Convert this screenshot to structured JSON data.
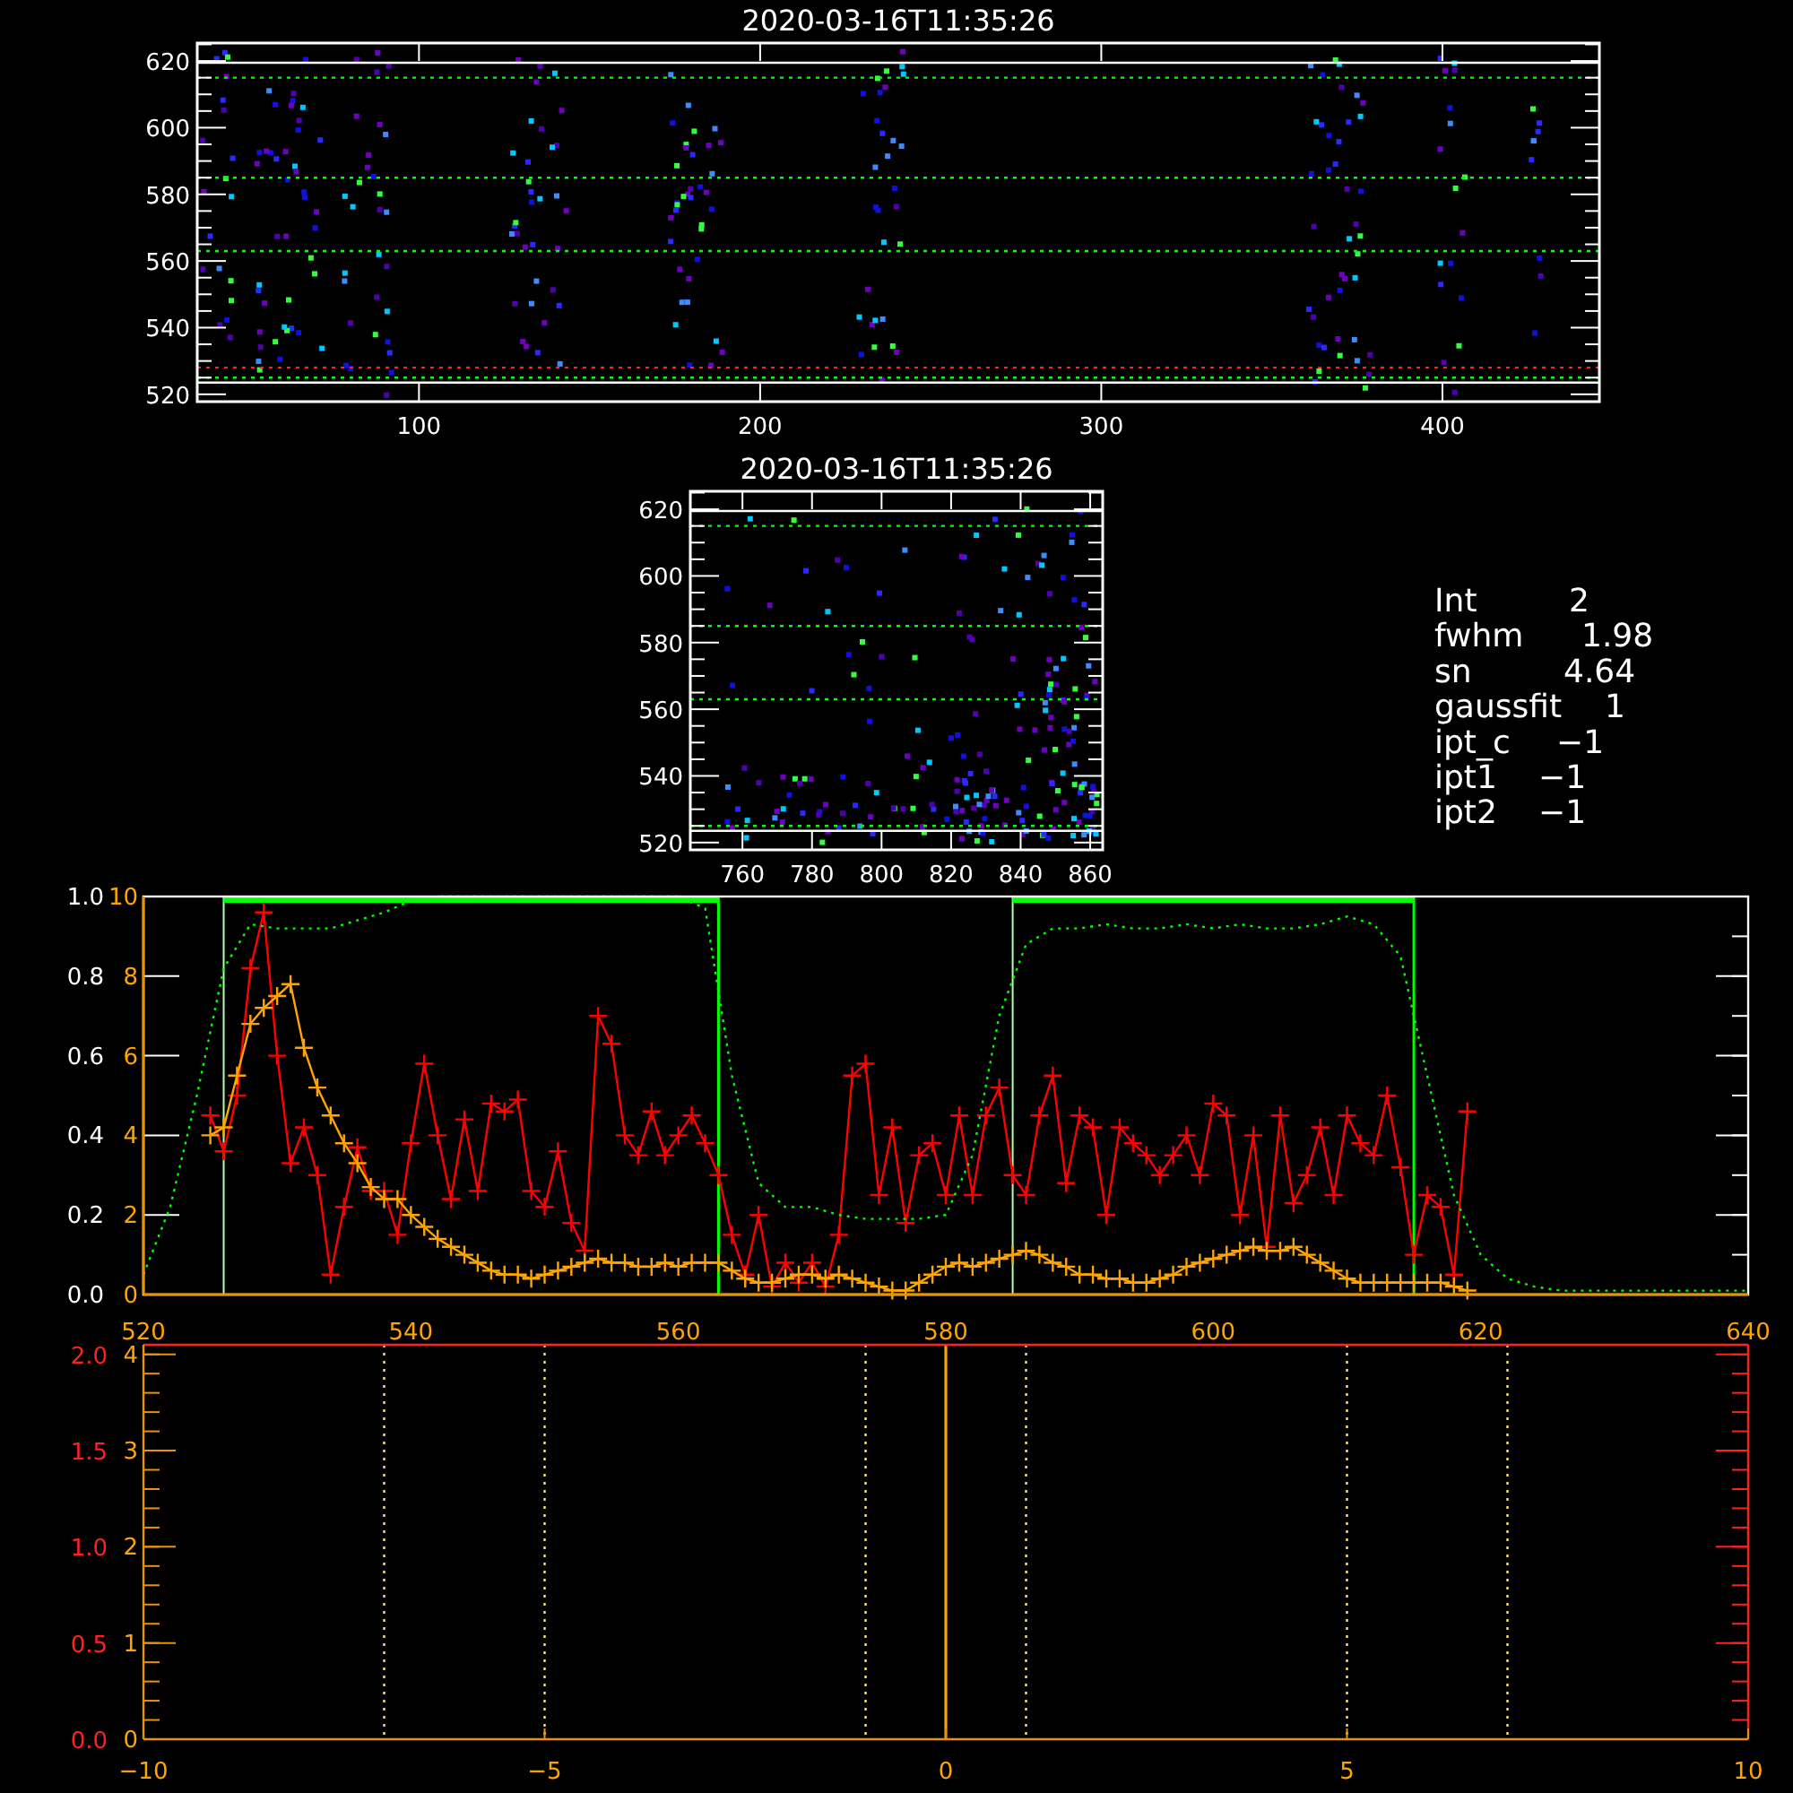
{
  "image_panels": [
    {
      "title": "2020-03-16T11:35:26",
      "xticks": [
        "100",
        "200",
        "300",
        "400"
      ],
      "yticks": [
        "620",
        "600",
        "580",
        "560",
        "540",
        "520"
      ]
    },
    {
      "title": "2020-03-16T11:35:26",
      "xticks": [
        "760",
        "780",
        "800",
        "820",
        "840",
        "860"
      ],
      "yticks": [
        "620",
        "600",
        "580",
        "560",
        "540",
        "520"
      ]
    }
  ],
  "fit_info": [
    {
      "label": "Int",
      "value": "2"
    },
    {
      "label": "fwhm",
      "value": "1.98"
    },
    {
      "label": "sn",
      "value": "4.64"
    },
    {
      "label": "gaussfit",
      "value": "1"
    },
    {
      "label": "ipt_c",
      "value": "−1"
    },
    {
      "label": "ipt1",
      "value": "−1"
    },
    {
      "label": "ipt2",
      "value": "−1"
    }
  ],
  "profile_plot": {
    "overlay_axis_labels": [
      "10",
      "8",
      "6",
      "4",
      "2",
      "0"
    ],
    "chart_data": {
      "type": "line",
      "xlim": [
        520,
        640
      ],
      "ylim": [
        0,
        1
      ],
      "xticks": [
        520,
        540,
        560,
        580,
        600,
        620,
        640
      ],
      "yticks": [
        {
          "value": 0,
          "label": "0.0"
        },
        {
          "value": 0.2,
          "label": "0.2"
        },
        {
          "value": 0.4,
          "label": "0.4"
        },
        {
          "value": 0.6,
          "label": "0.6"
        },
        {
          "value": 0.8,
          "label": "0.8"
        },
        {
          "value": 1,
          "label": "1.0"
        }
      ],
      "series": [
        {
          "color": "#ff0000",
          "line_style": "solid",
          "marker": "+",
          "x": [
            525,
            526,
            527,
            528,
            529,
            530,
            531,
            532,
            533,
            534,
            535,
            536,
            537,
            538,
            539,
            540,
            541,
            542,
            543,
            544,
            545,
            546,
            547,
            548,
            549,
            550,
            551,
            552,
            553,
            554,
            555,
            556,
            557,
            558,
            559,
            560,
            561,
            562,
            563,
            564,
            565,
            566,
            567,
            568,
            569,
            570,
            571,
            572,
            573,
            574,
            575,
            576,
            577,
            578,
            579,
            580,
            581,
            582,
            583,
            584,
            585,
            586,
            587,
            588,
            589,
            590,
            591,
            592,
            593,
            594,
            595,
            596,
            597,
            598,
            599,
            600,
            601,
            602,
            603,
            604,
            605,
            606,
            607,
            608,
            609,
            610,
            611,
            612,
            613,
            614,
            615,
            616,
            617,
            618,
            619
          ],
          "values": [
            0.45,
            0.36,
            0.5,
            0.82,
            0.96,
            0.6,
            0.33,
            0.42,
            0.3,
            0.05,
            0.22,
            0.37,
            0.26,
            0.26,
            0.15,
            0.38,
            0.58,
            0.4,
            0.24,
            0.44,
            0.26,
            0.48,
            0.46,
            0.49,
            0.26,
            0.22,
            0.36,
            0.18,
            0.11,
            0.7,
            0.63,
            0.4,
            0.35,
            0.46,
            0.35,
            0.4,
            0.45,
            0.38,
            0.3,
            0.15,
            0.05,
            0.2,
            0.02,
            0.08,
            0.03,
            0.08,
            0.02,
            0.15,
            0.55,
            0.58,
            0.25,
            0.42,
            0.18,
            0.35,
            0.38,
            0.25,
            0.45,
            0.25,
            0.45,
            0.52,
            0.3,
            0.25,
            0.45,
            0.55,
            0.28,
            0.45,
            0.42,
            0.2,
            0.42,
            0.38,
            0.35,
            0.3,
            0.35,
            0.4,
            0.3,
            0.48,
            0.45,
            0.2,
            0.4,
            0.12,
            0.45,
            0.23,
            0.3,
            0.42,
            0.25,
            0.45,
            0.38,
            0.35,
            0.5,
            0.32,
            0.1,
            0.25,
            0.22,
            0.05,
            0.46
          ]
        },
        {
          "color": "#ffa500",
          "line_style": "solid",
          "marker": "+",
          "x": [
            525,
            526,
            527,
            528,
            529,
            530,
            531,
            532,
            533,
            534,
            535,
            536,
            537,
            538,
            539,
            540,
            541,
            542,
            543,
            544,
            545,
            546,
            547,
            548,
            549,
            550,
            551,
            552,
            553,
            554,
            555,
            556,
            557,
            558,
            559,
            560,
            561,
            562,
            563,
            564,
            565,
            566,
            567,
            568,
            569,
            570,
            571,
            572,
            573,
            574,
            575,
            576,
            577,
            578,
            579,
            580,
            581,
            582,
            583,
            584,
            585,
            586,
            587,
            588,
            589,
            590,
            591,
            592,
            593,
            594,
            595,
            596,
            597,
            598,
            599,
            600,
            601,
            602,
            603,
            604,
            605,
            606,
            607,
            608,
            609,
            610,
            611,
            612,
            613,
            614,
            615,
            616,
            617,
            618,
            619
          ],
          "values": [
            0.4,
            0.42,
            0.55,
            0.68,
            0.72,
            0.75,
            0.78,
            0.62,
            0.52,
            0.45,
            0.38,
            0.33,
            0.27,
            0.24,
            0.24,
            0.2,
            0.17,
            0.14,
            0.12,
            0.1,
            0.08,
            0.06,
            0.05,
            0.05,
            0.04,
            0.05,
            0.06,
            0.07,
            0.08,
            0.09,
            0.08,
            0.08,
            0.07,
            0.07,
            0.08,
            0.07,
            0.08,
            0.08,
            0.08,
            0.06,
            0.04,
            0.03,
            0.03,
            0.04,
            0.05,
            0.05,
            0.04,
            0.05,
            0.04,
            0.03,
            0.02,
            0.01,
            0.01,
            0.03,
            0.05,
            0.07,
            0.08,
            0.07,
            0.08,
            0.09,
            0.1,
            0.11,
            0.1,
            0.08,
            0.07,
            0.05,
            0.05,
            0.04,
            0.04,
            0.03,
            0.03,
            0.04,
            0.05,
            0.07,
            0.08,
            0.09,
            0.1,
            0.11,
            0.12,
            0.11,
            0.11,
            0.12,
            0.1,
            0.08,
            0.06,
            0.04,
            0.03,
            0.03,
            0.03,
            0.03,
            0.03,
            0.03,
            0.03,
            0.02,
            0.01
          ]
        },
        {
          "color": "#00ff00",
          "line_style": "dotted",
          "x": [
            520,
            522,
            524,
            526,
            528,
            530,
            532,
            534,
            536,
            538,
            540,
            542,
            544,
            546,
            548,
            550,
            552,
            554,
            556,
            558,
            560,
            562,
            564,
            566,
            568,
            570,
            572,
            574,
            576,
            578,
            580,
            582,
            584,
            586,
            588,
            590,
            592,
            594,
            596,
            598,
            600,
            602,
            604,
            606,
            608,
            610,
            612,
            614,
            616,
            618,
            620,
            622,
            624,
            626,
            628,
            630,
            632,
            634,
            636,
            638,
            640
          ],
          "values": [
            0.05,
            0.22,
            0.5,
            0.82,
            0.93,
            0.92,
            0.92,
            0.92,
            0.94,
            0.96,
            0.99,
            1,
            1,
            1,
            1,
            1,
            1,
            1,
            1,
            1,
            1,
            0.97,
            0.55,
            0.28,
            0.22,
            0.22,
            0.2,
            0.19,
            0.19,
            0.19,
            0.2,
            0.35,
            0.7,
            0.88,
            0.92,
            0.92,
            0.93,
            0.92,
            0.92,
            0.93,
            0.92,
            0.93,
            0.92,
            0.92,
            0.93,
            0.95,
            0.93,
            0.85,
            0.55,
            0.25,
            0.1,
            0.04,
            0.02,
            0.01,
            0.01,
            0.01,
            0.01,
            0.01,
            0.01,
            0.01,
            0.01
          ]
        }
      ]
    }
  },
  "offset_plot": {
    "overlay_axis_labels": [
      "4",
      "3",
      "2",
      "1",
      "0"
    ],
    "chart_data": {
      "type": "line",
      "xlim": [
        -10,
        10
      ],
      "ylim": [
        0,
        2.05
      ],
      "xticks": [
        {
          "value": -10,
          "label": "−10"
        },
        {
          "value": -5,
          "label": "−5"
        },
        {
          "value": 0,
          "label": "0"
        },
        {
          "value": 5,
          "label": "5"
        },
        {
          "value": 10,
          "label": "10"
        }
      ],
      "yticks": [
        {
          "value": 0,
          "label": "0.0"
        },
        {
          "value": 0.5,
          "label": "0.5"
        },
        {
          "value": 1,
          "label": "1.0"
        },
        {
          "value": 1.5,
          "label": "1.5"
        },
        {
          "value": 2,
          "label": "2.0"
        }
      ],
      "ref_lines": [
        {
          "axis": "x",
          "value": -7,
          "line_style": "dotted"
        },
        {
          "axis": "x",
          "value": -5,
          "line_style": "dotted"
        },
        {
          "axis": "x",
          "value": -1,
          "line_style": "dotted"
        },
        {
          "axis": "x",
          "value": 0,
          "line_style": "solid"
        },
        {
          "axis": "x",
          "value": 1,
          "line_style": "dotted"
        },
        {
          "axis": "x",
          "value": 5,
          "line_style": "dotted"
        },
        {
          "axis": "x",
          "value": 7,
          "line_style": "dotted"
        }
      ]
    }
  }
}
